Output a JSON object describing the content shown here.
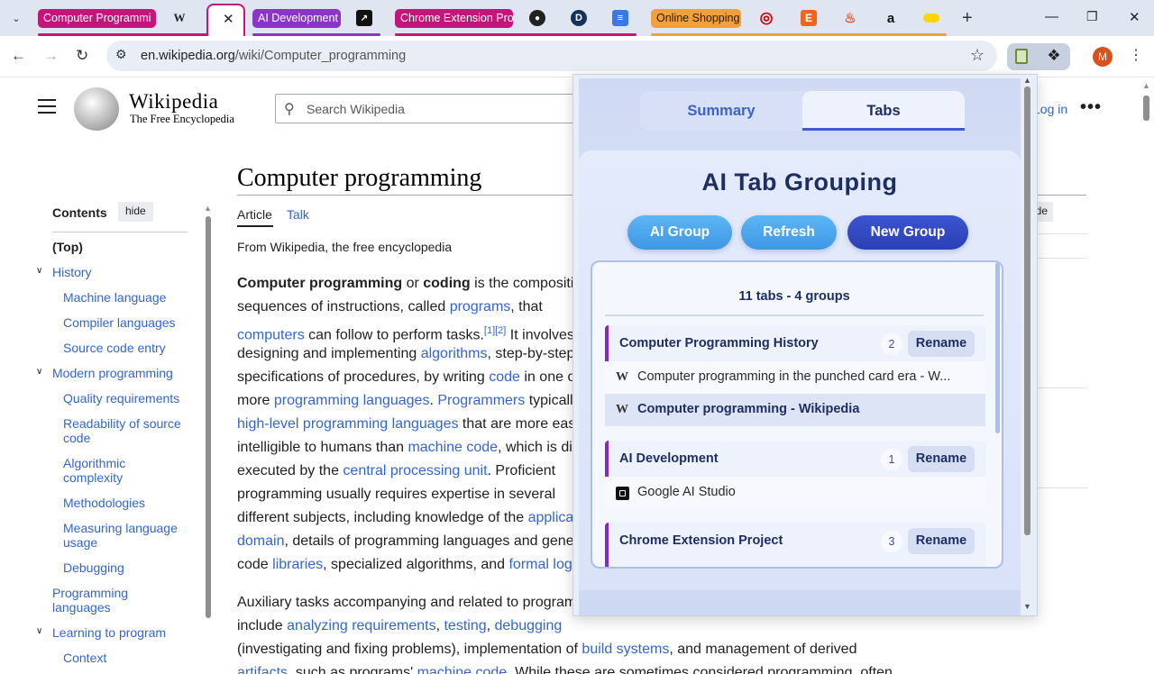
{
  "browser": {
    "tab_groups": [
      {
        "label": "Computer Programmi",
        "color": "#c4167a"
      },
      {
        "label": "AI Development",
        "color": "#8a34c9"
      },
      {
        "label": "Chrome Extension Pro",
        "color": "#c4167a"
      },
      {
        "label": "Online Shopping",
        "color": "#f2a13a"
      }
    ],
    "favicons": [
      "wikipedia-icon",
      "ai-studio-icon",
      "github-icon",
      "d-app-icon",
      "google-docs-icon",
      "target-icon",
      "etsy-icon",
      "flame-icon",
      "amazon-icon",
      "yellow-group-icon"
    ],
    "url_host": "en.wikipedia.org",
    "url_path": "/wiki/Computer_programming",
    "profile_initial": "M"
  },
  "wikipedia": {
    "wordmark": "Wikipedia",
    "tagline": "The Free Encyclopedia",
    "search_placeholder": "Search Wikipedia",
    "login": "Log in",
    "title": "Computer programming",
    "tab_article": "Article",
    "tab_talk": "Talk",
    "from": "From Wikipedia, the free encyclopedia",
    "side_hide": "ide",
    "toc": {
      "title": "Contents",
      "hide": "hide",
      "items": [
        {
          "label": "(Top)"
        },
        {
          "label": "History"
        },
        {
          "label": "Machine language"
        },
        {
          "label": "Compiler languages"
        },
        {
          "label": "Source code entry"
        },
        {
          "label": "Modern programming"
        },
        {
          "label": "Quality requirements"
        },
        {
          "label": "Readability of source code"
        },
        {
          "label": "Algorithmic complexity"
        },
        {
          "label": "Methodologies"
        },
        {
          "label": "Measuring language usage"
        },
        {
          "label": "Debugging"
        },
        {
          "label": "Programming languages"
        },
        {
          "label": "Learning to program"
        },
        {
          "label": "Context"
        }
      ]
    },
    "body": {
      "l1a": "Computer programming",
      "l1b": " or ",
      "l1c": "coding",
      "l1d": " is the compositi",
      "l2a": "sequences of instructions, called ",
      "l2b": "programs",
      "l2c": ", that",
      "l3a": "computers",
      "l3b": " can follow to perform tasks.",
      "l3c": "[1][2]",
      "l3d": " It involves",
      "l4a": "designing and implementing ",
      "l4b": "algorithms",
      "l4c": ", step-by-step",
      "l5a": "specifications of procedures, by writing ",
      "l5b": "code",
      "l5c": " in one o",
      "l6a": "more ",
      "l6b": "programming languages",
      "l6c": ". ",
      "l6d": "Programmers",
      "l6e": " typicall",
      "l7a": "high-level programming languages",
      "l7b": " that are more eas",
      "l8a": "intelligible to humans than ",
      "l8b": "machine code",
      "l8c": ", which is di",
      "l9a": "executed by the ",
      "l9b": "central processing unit",
      "l9c": ". Proficient",
      "l10": "programming usually requires expertise in several",
      "l11a": "different subjects, including knowledge of the ",
      "l11b": "applica",
      "l12a": "domain",
      "l12b": ", details of programming languages and gene",
      "l13a": "code ",
      "l13b": "libraries",
      "l13c": ", specialized algorithms, and ",
      "l13d": "formal log",
      "p2l1": "Auxiliary tasks accompanying and related to program",
      "p2l2a": "include ",
      "p2l2b": "analyzing requirements",
      "p2l2c": ", ",
      "p2l2d": "testing",
      "p2l2e": ", ",
      "p2l2f": "debugging",
      "p2l3a": "(investigating and fixing problems), implementation of ",
      "p2l3b": "build systems",
      "p2l3c": ", and management of derived",
      "p2l4a": "artifacts",
      "p2l4b": ", such as programs' ",
      "p2l4c": "machine code",
      "p2l4d": ". While these are sometimes considered programming, often"
    }
  },
  "extension": {
    "tab_summary": "Summary",
    "tab_tabs": "Tabs",
    "title": "AI Tab Grouping",
    "btn_ai_group": "AI Group",
    "btn_refresh": "Refresh",
    "btn_new_group": "New Group",
    "summary_line": "11 tabs - 4 groups",
    "rename_label": "Rename",
    "groups": [
      {
        "name": "Computer Programming History",
        "count": "2",
        "color": "#7b2bd0",
        "tabs": [
          {
            "title": "Computer programming in the punched card era - W...",
            "icon": "wikipedia-icon"
          },
          {
            "title": "Computer programming - Wikipedia",
            "icon": "wikipedia-icon"
          }
        ]
      },
      {
        "name": "AI Development",
        "count": "1",
        "color": "#7b2bd0",
        "tabs": [
          {
            "title": "Google AI Studio",
            "icon": "ai-studio-icon"
          }
        ]
      },
      {
        "name": "Chrome Extension Project",
        "count": "3",
        "color": "#7b2bd0",
        "tabs": []
      }
    ]
  }
}
